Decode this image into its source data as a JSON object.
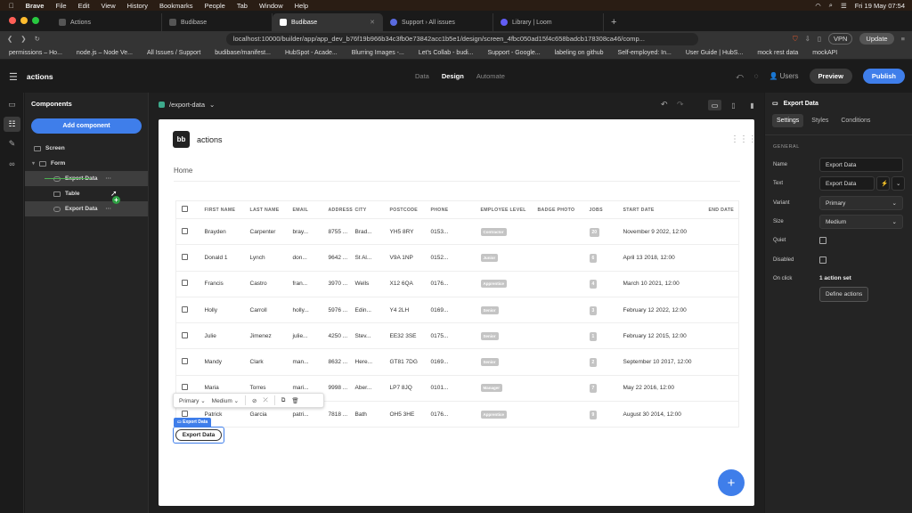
{
  "menubar": {
    "app": "Brave",
    "items": [
      "File",
      "Edit",
      "View",
      "History",
      "Bookmarks",
      "People",
      "Tab",
      "Window",
      "Help"
    ],
    "clock": "Fri 19 May  07:54"
  },
  "tabs": [
    {
      "label": "Actions",
      "active": false
    },
    {
      "label": "Budibase",
      "active": false
    },
    {
      "label": "Budibase",
      "active": true
    },
    {
      "label": "Support › All issues",
      "active": false
    },
    {
      "label": "Library | Loom",
      "active": false
    }
  ],
  "address": {
    "url": "localhost:10000/builder/app/app_dev_b76f19b966b34c3fb0e73842acc1b5e1/design/screen_4fbc050ad15f4c658badcb178308ca46/comp...",
    "vpn": "VPN",
    "update": "Update"
  },
  "bookmarks": [
    "permissions – Ho...",
    "node.js – Node Ve...",
    "All Issues / Support",
    "budibase/manifest...",
    "HubSpot - Acade...",
    "Blurring Images -...",
    "Let's Collab - budi...",
    "Support - Google...",
    "labeling on github",
    "Self-employed: In...",
    "User Guide | HubS...",
    "mock rest data",
    "mockAPI"
  ],
  "app": {
    "name": "actions",
    "nav": [
      "Data",
      "Design",
      "Automate"
    ],
    "active_nav": "Design",
    "users": "Users",
    "preview": "Preview",
    "publish": "Publish"
  },
  "components": {
    "title": "Components",
    "add": "Add component",
    "tree": [
      {
        "label": "Screen"
      },
      {
        "label": "Form"
      },
      {
        "label": "Export Data"
      },
      {
        "label": "Table"
      },
      {
        "label": "Export Data"
      }
    ]
  },
  "canvas": {
    "route": "/export-data",
    "logo": "bb",
    "app_title": "actions",
    "home": "Home",
    "table": {
      "headers": [
        "FIRST NAME",
        "LAST NAME",
        "EMAIL",
        "ADDRESS",
        "CITY",
        "POSTCODE",
        "PHONE",
        "EMPLOYEE LEVEL",
        "BADGE PHOTO",
        "JOBS",
        "START DATE",
        "END DATE"
      ],
      "rows": [
        [
          "Brayden",
          "Carpenter",
          "bray...",
          "8755 ...",
          "Brad...",
          "YH5 8RY",
          "0153...",
          "Contractor",
          "",
          "20",
          "November 9 2022, 12:00",
          ""
        ],
        [
          "Donald 1",
          "Lynch",
          "don...",
          "9642 ...",
          "St Al...",
          "V9A 1NP",
          "0152...",
          "Junior",
          "",
          "6",
          "April 13 2018, 12:00",
          ""
        ],
        [
          "Francis",
          "Castro",
          "fran...",
          "3970 ...",
          "Wells",
          "X12 6QA",
          "0176...",
          "Apprentice",
          "",
          "4",
          "March 10 2021, 12:00",
          ""
        ],
        [
          "Holly",
          "Carroll",
          "holly...",
          "5976 ...",
          "Edin...",
          "Y4 2LH",
          "0169...",
          "Senior",
          "",
          "3",
          "February 12 2022, 12:00",
          ""
        ],
        [
          "Julie",
          "Jimenez",
          "julie...",
          "4250 ...",
          "Stev...",
          "EE32 3SE",
          "0175...",
          "Senior",
          "",
          "1",
          "February 12 2015, 12:00",
          ""
        ],
        [
          "Mandy",
          "Clark",
          "man...",
          "8632 ...",
          "Here...",
          "GT81 7DG",
          "0169...",
          "Senior",
          "",
          "2",
          "September 10 2017, 12:00",
          ""
        ],
        [
          "Maria",
          "Torres",
          "mari...",
          "9998 ...",
          "Aber...",
          "LP7 8JQ",
          "0101...",
          "Manager",
          "",
          "7",
          "May 22 2016, 12:00",
          ""
        ],
        [
          "Patrick",
          "Garcia",
          "patri...",
          "7818 ...",
          "Bath",
          "OH5 3HE",
          "0176...",
          "Apprentice",
          "",
          "9",
          "August 30 2014, 12:00",
          ""
        ]
      ]
    },
    "toolbar": {
      "variant": "Primary",
      "size": "Medium"
    },
    "selected_tag": "Export Data",
    "export_button": "Export Data"
  },
  "settings": {
    "component": "Export Data",
    "tabs": [
      "Settings",
      "Styles",
      "Conditions"
    ],
    "active_tab": "Settings",
    "section": "GENERAL",
    "fields": {
      "name_label": "Name",
      "name_value": "Export Data",
      "text_label": "Text",
      "text_value": "Export Data",
      "variant_label": "Variant",
      "variant_value": "Primary",
      "size_label": "Size",
      "size_value": "Medium",
      "quiet_label": "Quiet",
      "disabled_label": "Disabled",
      "onclick_label": "On click",
      "onclick_value": "1 action set",
      "define_actions": "Define actions"
    }
  },
  "colors": {
    "accent": "#3f7eea",
    "success": "#2ea043",
    "route": "#3daa8c"
  }
}
